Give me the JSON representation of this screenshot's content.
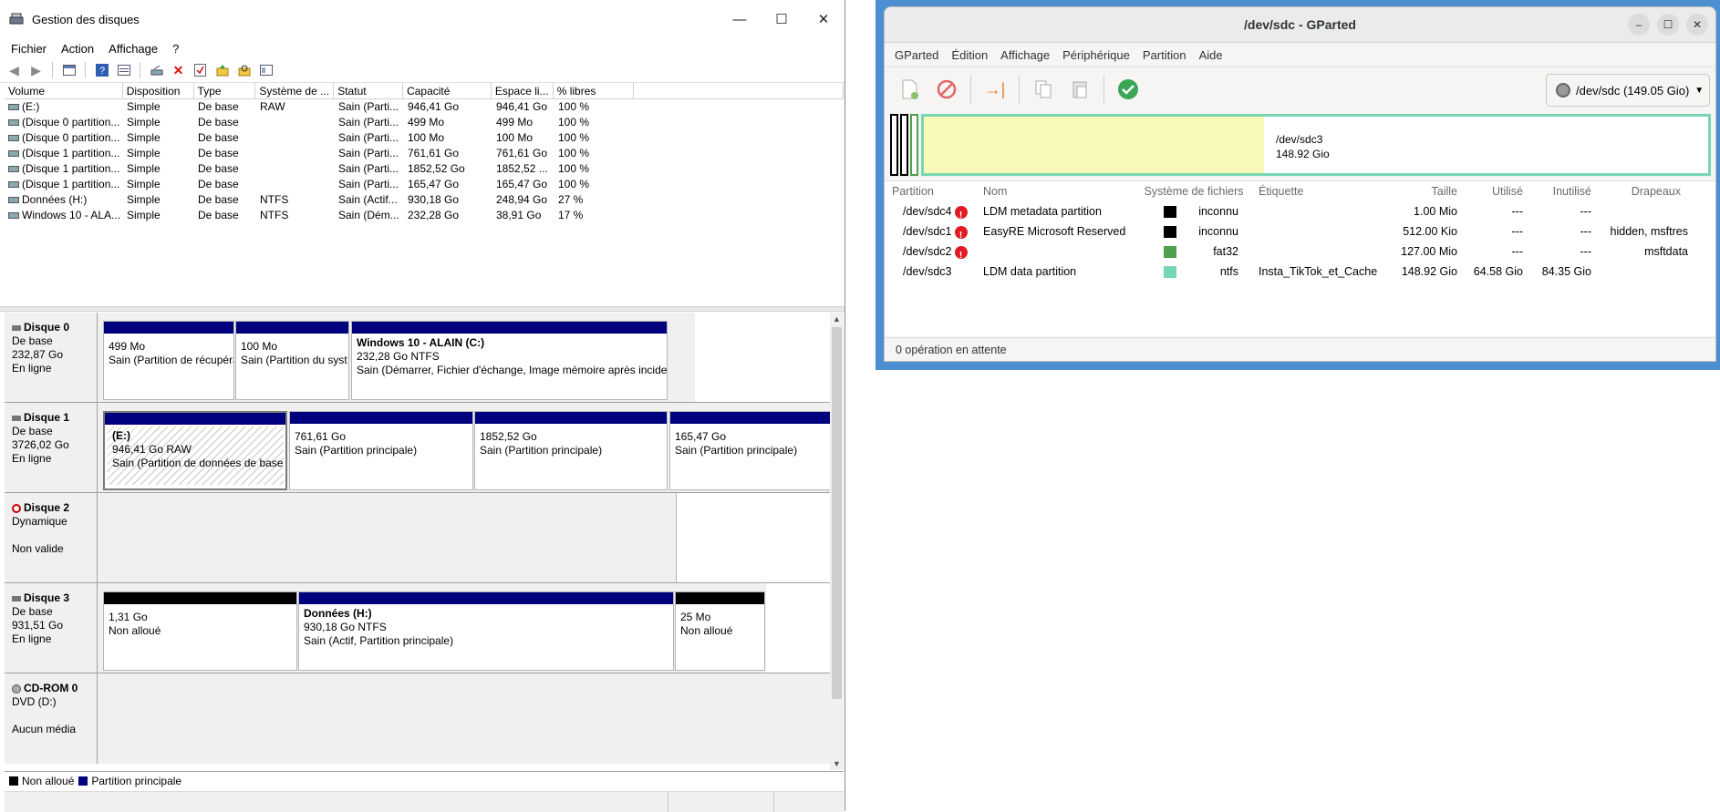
{
  "disk_mgmt": {
    "title": "Gestion des disques",
    "window_controls": {
      "minimize": "—",
      "maximize": "☐",
      "close": "✕"
    },
    "menu": [
      "Fichier",
      "Action",
      "Affichage",
      "?"
    ],
    "columns": [
      "Volume",
      "Disposition",
      "Type",
      "Système de ...",
      "Statut",
      "Capacité",
      "Espace li...",
      "% libres"
    ],
    "volumes": [
      [
        "(E:)",
        "Simple",
        "De base",
        "RAW",
        "Sain (Parti...",
        "946,41 Go",
        "946,41 Go",
        "100 %"
      ],
      [
        "(Disque 0 partition...",
        "Simple",
        "De base",
        "",
        "Sain (Parti...",
        "499 Mo",
        "499 Mo",
        "100 %"
      ],
      [
        "(Disque 0 partition...",
        "Simple",
        "De base",
        "",
        "Sain (Parti...",
        "100 Mo",
        "100 Mo",
        "100 %"
      ],
      [
        "(Disque 1 partition...",
        "Simple",
        "De base",
        "",
        "Sain (Parti...",
        "761,61 Go",
        "761,61 Go",
        "100 %"
      ],
      [
        "(Disque 1 partition...",
        "Simple",
        "De base",
        "",
        "Sain (Parti...",
        "1852,52 Go",
        "1852,52 ...",
        "100 %"
      ],
      [
        "(Disque 1 partition...",
        "Simple",
        "De base",
        "",
        "Sain (Parti...",
        "165,47 Go",
        "165,47 Go",
        "100 %"
      ],
      [
        "Données (H:)",
        "Simple",
        "De base",
        "NTFS",
        "Sain (Actif...",
        "930,18 Go",
        "248,94 Go",
        "27 %"
      ],
      [
        "Windows 10 - ALA...",
        "Simple",
        "De base",
        "NTFS",
        "Sain (Dém...",
        "232,28 Go",
        "38,91 Go",
        "17 %"
      ]
    ],
    "disks": {
      "d0": {
        "name": "Disque 0",
        "l1": "De base",
        "l2": "232,87 Go",
        "l3": "En ligne",
        "p1": {
          "l1": "499 Mo",
          "l2": "Sain (Partition de récupération"
        },
        "p2": {
          "l1": "100 Mo",
          "l2": "Sain (Partition du syst"
        },
        "p3": {
          "t": "Windows 10 - ALAIN  (C:)",
          "l1": "232,28 Go NTFS",
          "l2": "Sain (Démarrer, Fichier d'échange, Image mémoire après incide"
        }
      },
      "d1": {
        "name": "Disque 1",
        "l1": "De base",
        "l2": "3726,02 Go",
        "l3": "En ligne",
        "p1": {
          "t": "(E:)",
          "l1": "946,41 Go RAW",
          "l2": "Sain (Partition de données de base)"
        },
        "p2": {
          "l1": "761,61 Go",
          "l2": "Sain (Partition principale)"
        },
        "p3": {
          "l1": "1852,52 Go",
          "l2": "Sain (Partition principale)"
        },
        "p4": {
          "l1": "165,47 Go",
          "l2": "Sain (Partition principale)"
        }
      },
      "d2": {
        "name": "Disque 2",
        "l1": "Dynamique",
        "l3": "Non valide"
      },
      "d3": {
        "name": "Disque 3",
        "l1": "De base",
        "l2": "931,51 Go",
        "l3": "En ligne",
        "p1": {
          "l1": "1,31 Go",
          "l2": "Non alloué"
        },
        "p2": {
          "t": "Données  (H:)",
          "l1": "930,18 Go NTFS",
          "l2": "Sain (Actif, Partition principale)"
        },
        "p3": {
          "l1": "25 Mo",
          "l2": "Non alloué"
        }
      },
      "cd": {
        "name": "CD-ROM 0",
        "l1": "DVD (D:)",
        "l3": "Aucun média"
      }
    },
    "legend": {
      "unalloc": "Non alloué",
      "primary": "Partition principale"
    },
    "colors": {
      "primary": "#00007f",
      "unallocated": "#000000"
    }
  },
  "gparted": {
    "title": "/dev/sdc - GParted",
    "menu": [
      "GParted",
      "Édition",
      "Affichage",
      "Périphérique",
      "Partition",
      "Aide"
    ],
    "device": "/dev/sdc (149.05 Gio)",
    "graph": {
      "name": "/dev/sdc3",
      "size": "148.92 Gio",
      "used_fraction": 0.434
    },
    "columns": [
      "Partition",
      "Nom",
      "Système de fichiers",
      "Étiquette",
      "Taille",
      "Utilisé",
      "Inutilisé",
      "Drapeaux"
    ],
    "rows": [
      {
        "part": "/dev/sdc4",
        "warn": true,
        "name": "LDM metadata partition",
        "fs": "inconnu",
        "fs_color": "#000000",
        "label": "",
        "size": "1.00 Mio",
        "used": "---",
        "unused": "---",
        "flags": ""
      },
      {
        "part": "/dev/sdc1",
        "warn": true,
        "name": "EasyRE Microsoft Reserved",
        "fs": "inconnu",
        "fs_color": "#000000",
        "label": "",
        "size": "512.00 Kio",
        "used": "---",
        "unused": "---",
        "flags": "hidden, msftres"
      },
      {
        "part": "/dev/sdc2",
        "warn": true,
        "name": "",
        "fs": "fat32",
        "fs_color": "#4ea04e",
        "label": "",
        "size": "127.00 Mio",
        "used": "---",
        "unused": "---",
        "flags": "msftdata"
      },
      {
        "part": "/dev/sdc3",
        "warn": false,
        "name": "LDM data partition",
        "fs": "ntfs",
        "fs_color": "#76d7b2",
        "label": "Insta_TikTok_et_Cache",
        "size": "148.92 Gio",
        "used": "64.58 Gio",
        "unused": "84.35 Gio",
        "flags": ""
      }
    ],
    "status": "0 opération en attente"
  }
}
